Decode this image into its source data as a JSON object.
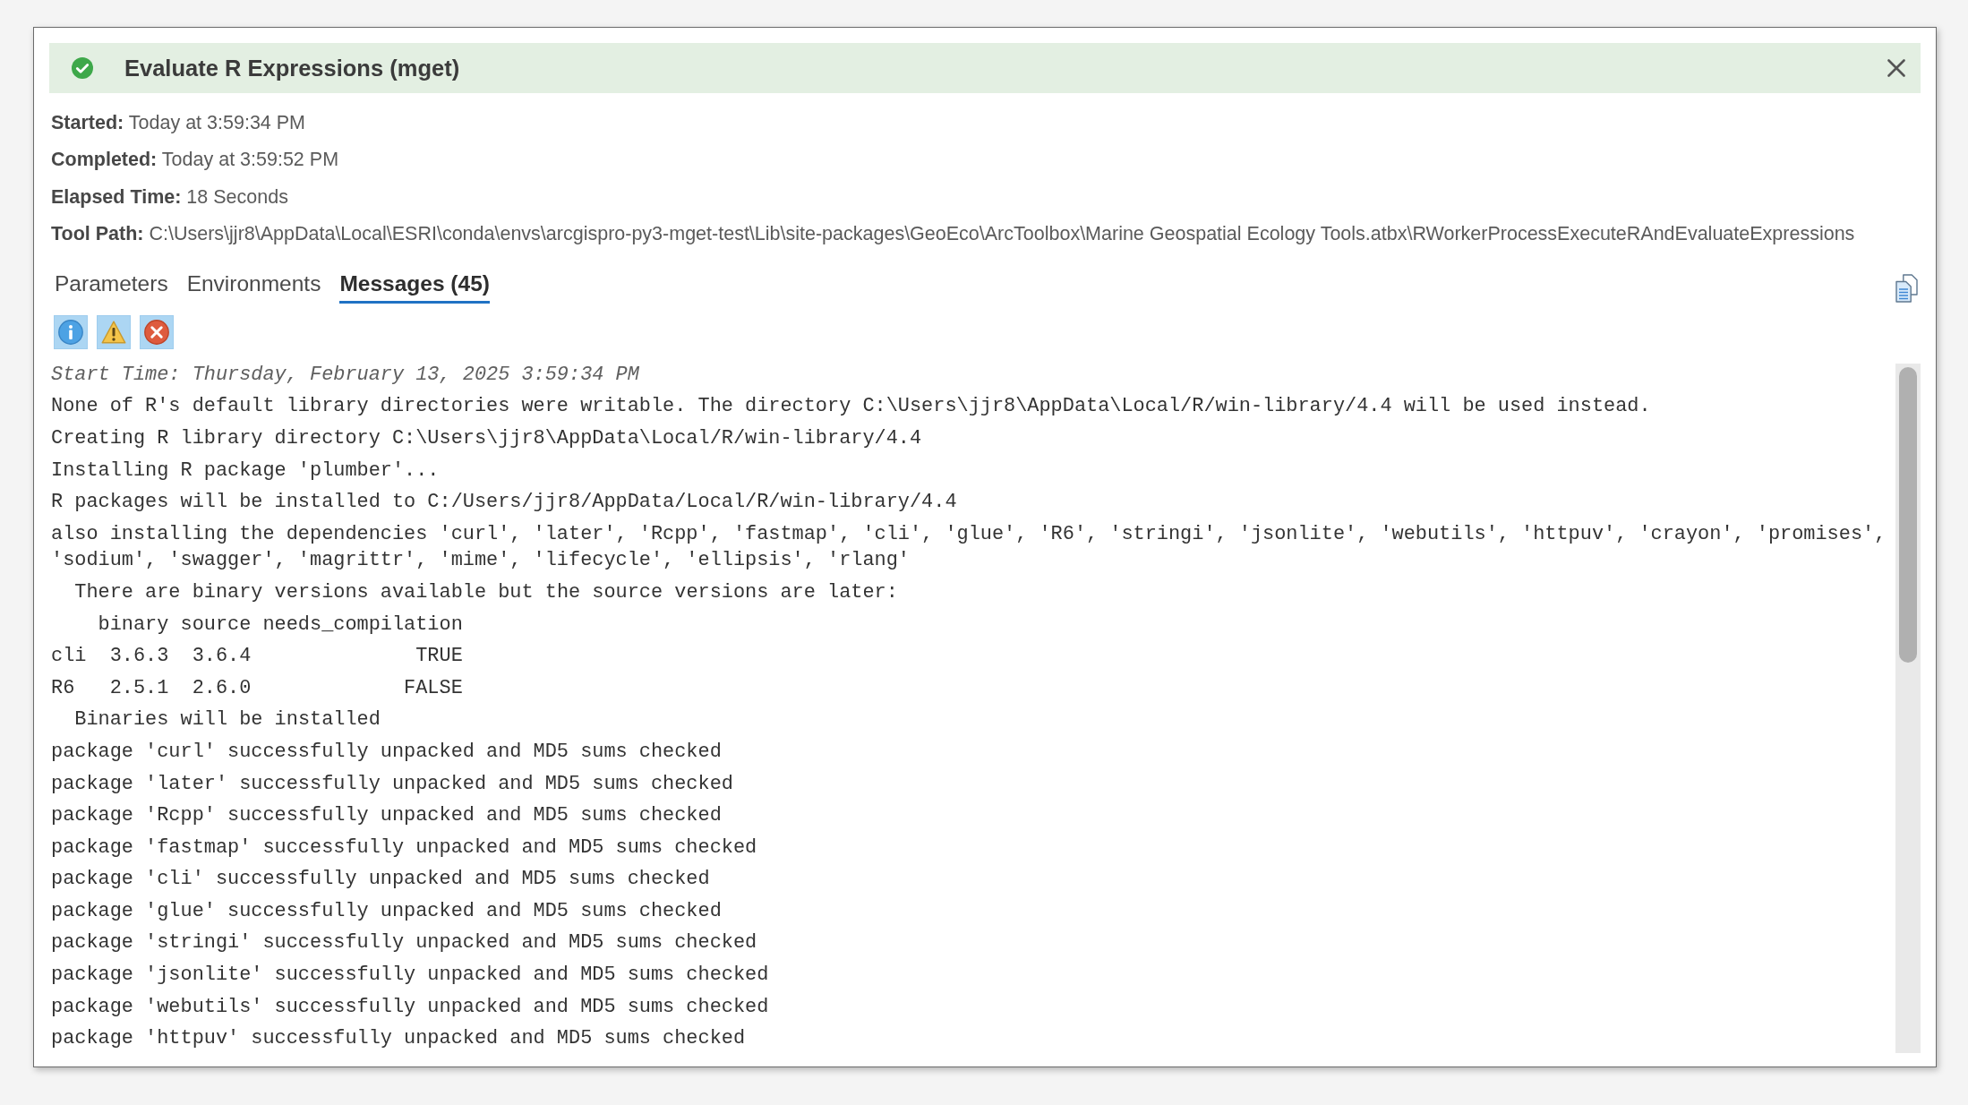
{
  "dialog": {
    "succeeded": true,
    "title": "Evaluate R Expressions (mget)"
  },
  "details": [
    {
      "text": "**Started:** Today at 3:59:34 PM"
    },
    {
      "text": "**Completed:** Today at 3:59:52 PM"
    },
    {
      "text": "**Elapsed Time:** 18 Seconds"
    },
    {
      "text": "**Tool Path:** C:\\Users\\jjr8\\AppData\\Local\\ESRI\\conda\\envs\\arcgispro-py3-mget-test\\Lib\\site-packages\\GeoEco\\ArcToolbox\\Marine Geospatial Ecology Tools.atbx\\RWorkerProcessExecuteRAndEvaluateExpressions"
    }
  ],
  "tabs": [
    {
      "label": "Parameters",
      "selected": false
    },
    {
      "label": "Environments",
      "selected": false
    },
    {
      "label": "Messages (45)",
      "selected": true
    }
  ],
  "filters": [
    {
      "kind": "info",
      "on": true
    },
    {
      "kind": "warning",
      "on": true
    },
    {
      "kind": "error",
      "on": true
    }
  ],
  "messages": [
    {
      "kind": "start_time",
      "text": "Start Time: Thursday, February 13, 2025 3:59:34 PM"
    },
    {
      "kind": "message",
      "text": "None of R's default library directories were writable. The directory C:\\Users\\jjr8\\AppData\\Local/R/win-library/4.4 will be used instead."
    },
    {
      "kind": "message",
      "text": "Creating R library directory C:\\Users\\jjr8\\AppData\\Local/R/win-library/4.4"
    },
    {
      "kind": "message",
      "text": "Installing R package 'plumber'..."
    },
    {
      "kind": "message",
      "text": "R packages will be installed to C:/Users/jjr8/AppData/Local/R/win-library/4.4"
    },
    {
      "kind": "message",
      "text": "also installing the dependencies 'curl', 'later', 'Rcpp', 'fastmap', 'cli', 'glue', 'R6', 'stringi', 'jsonlite', 'webutils', 'httpuv', 'crayon', 'promises', 'sodium', 'swagger', 'magrittr', 'mime', 'lifecycle', 'ellipsis', 'rlang'"
    },
    {
      "kind": "message",
      "text": "  There are binary versions available but the source versions are later:"
    },
    {
      "kind": "message",
      "text": "    binary source needs_compilation"
    },
    {
      "kind": "message",
      "text": "cli  3.6.3  3.6.4              TRUE"
    },
    {
      "kind": "message",
      "text": "R6   2.5.1  2.6.0             FALSE"
    },
    {
      "kind": "message",
      "text": "  Binaries will be installed"
    },
    {
      "kind": "message",
      "text": "package 'curl' successfully unpacked and MD5 sums checked"
    },
    {
      "kind": "message",
      "text": "package 'later' successfully unpacked and MD5 sums checked"
    },
    {
      "kind": "message",
      "text": "package 'Rcpp' successfully unpacked and MD5 sums checked"
    },
    {
      "kind": "message",
      "text": "package 'fastmap' successfully unpacked and MD5 sums checked"
    },
    {
      "kind": "message",
      "text": "package 'cli' successfully unpacked and MD5 sums checked"
    },
    {
      "kind": "message",
      "text": "package 'glue' successfully unpacked and MD5 sums checked"
    },
    {
      "kind": "message",
      "text": "package 'stringi' successfully unpacked and MD5 sums checked"
    },
    {
      "kind": "message",
      "text": "package 'jsonlite' successfully unpacked and MD5 sums checked"
    },
    {
      "kind": "message",
      "text": "package 'webutils' successfully unpacked and MD5 sums checked"
    },
    {
      "kind": "message",
      "text": "package 'httpuv' successfully unpacked and MD5 sums checked"
    }
  ]
}
